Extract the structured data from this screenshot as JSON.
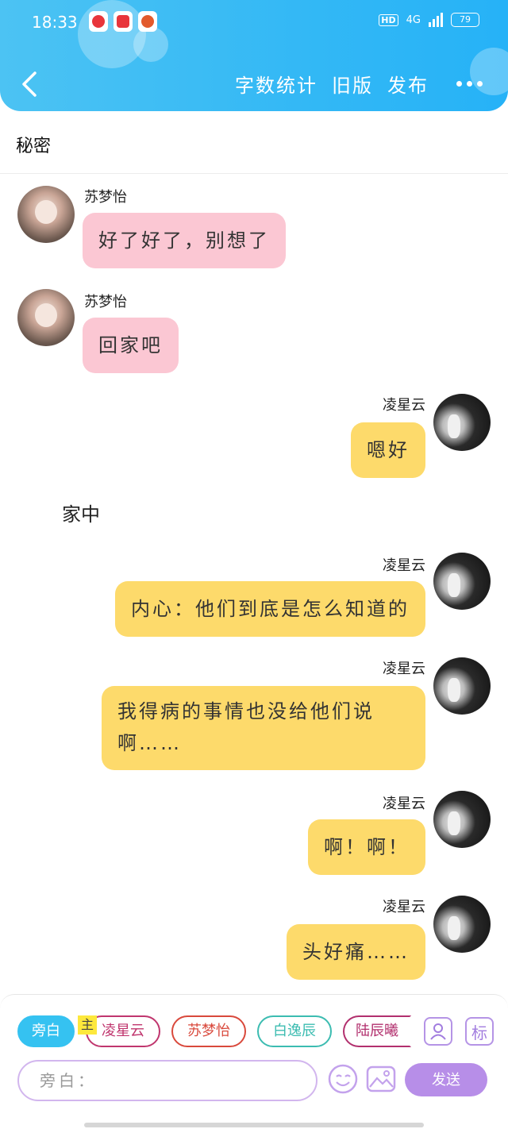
{
  "status_bar": {
    "time": "18:33",
    "network": "4G",
    "hd": "HD",
    "battery": "79"
  },
  "header": {
    "back_icon": "chevron-left-icon",
    "actions": [
      "字数统计",
      "旧版",
      "发布"
    ],
    "more_icon": "more-dots-icon",
    "accent_color": "#33b8f5"
  },
  "scene_title": "秘密",
  "messages": [
    {
      "sender": "苏梦怡",
      "text": "好了好了，别想了",
      "side": "left"
    },
    {
      "sender": "苏梦怡",
      "text": "回家吧",
      "side": "left"
    },
    {
      "sender": "凌星云",
      "text": "嗯好",
      "side": "right"
    },
    {
      "sender": "凌星云",
      "text": "内心：他们到底是怎么知道的",
      "side": "right"
    },
    {
      "sender": "凌星云",
      "text_line1": "我得病的事情也没给他们说",
      "text_line2": "啊……",
      "side": "right"
    },
    {
      "sender": "凌星云",
      "text": "啊！啊！",
      "side": "right"
    },
    {
      "sender": "凌星云",
      "text": "头好痛……",
      "side": "right"
    }
  ],
  "scene_inline": "家中",
  "composer": {
    "roles": [
      "旁白",
      "凌星云",
      "苏梦怡",
      "白逸辰",
      "陆辰曦"
    ],
    "role_colors": [
      "#35c2f1",
      "#c0366e",
      "#d9493c",
      "#3cbcb1",
      "#b2306e"
    ],
    "main_tag": "主",
    "tag_button_label": "标",
    "placeholder": "旁白：",
    "send_label": "发送"
  }
}
